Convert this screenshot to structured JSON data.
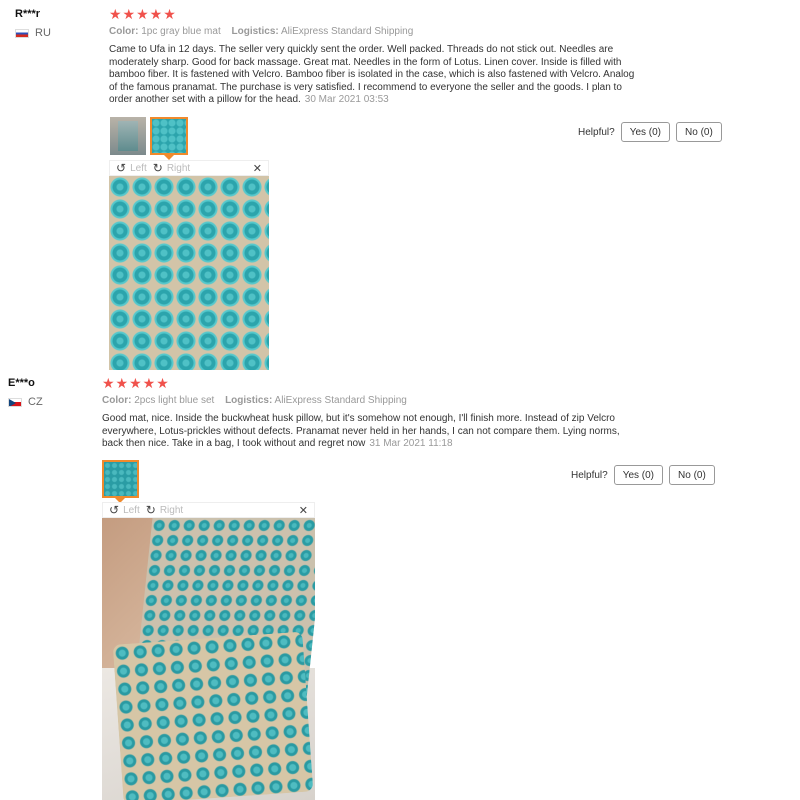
{
  "reviews": [
    {
      "user": "R***r",
      "country": "RU",
      "stars": "★★★★★",
      "color_label": "Color:",
      "color_value": "1pc gray blue mat",
      "logistics_label": "Logistics:",
      "logistics_value": "AliExpress Standard Shipping",
      "text": "Came to Ufa in 12 days. The seller very quickly sent the order. Well packed. Threads do not stick out. Needles are moderately sharp. Good for back massage. Great mat. Needles in the form of Lotus. Linen cover. Inside is filled with bamboo fiber. It is fastened with Velcro. Bamboo fiber is isolated in the case, which is also fastened with Velcro. Analog of the famous pranamat. The purchase is very satisfied. I recommend to everyone the seller and the goods. I plan to order another set with a pillow for the head.",
      "date": "30 Mar 2021 03:53",
      "helpful_label": "Helpful?",
      "yes_label": "Yes (0)",
      "no_label": "No (0)",
      "viewer": {
        "left_label": "Left",
        "right_label": "Right",
        "close": "✕"
      }
    },
    {
      "user": "E***o",
      "country": "CZ",
      "stars": "★★★★★",
      "color_label": "Color:",
      "color_value": "2pcs light blue set",
      "logistics_label": "Logistics:",
      "logistics_value": "AliExpress Standard Shipping",
      "text": "Good mat, nice. Inside the buckwheat husk pillow, but it's somehow not enough, I'll finish more. Instead of zip Velcro everywhere, Lotus-prickles without defects. Pranamat never held in her hands, I can not compare them. Lying norms, back then nice. Take in a bag, I took without and regret now",
      "date": "31 Mar 2021 11:18",
      "helpful_label": "Helpful?",
      "yes_label": "Yes (0)",
      "no_label": "No (0)",
      "viewer": {
        "left_label": "Left",
        "right_label": "Right",
        "close": "✕"
      }
    }
  ],
  "icons": {
    "rotate_left": "rotate-left-icon",
    "rotate_right": "rotate-right-icon",
    "close": "close-icon"
  },
  "colors": {
    "stars": "#f0524c",
    "thumb_selected_border": "#f08a2c",
    "mat_teal": "#2ca4ac"
  }
}
